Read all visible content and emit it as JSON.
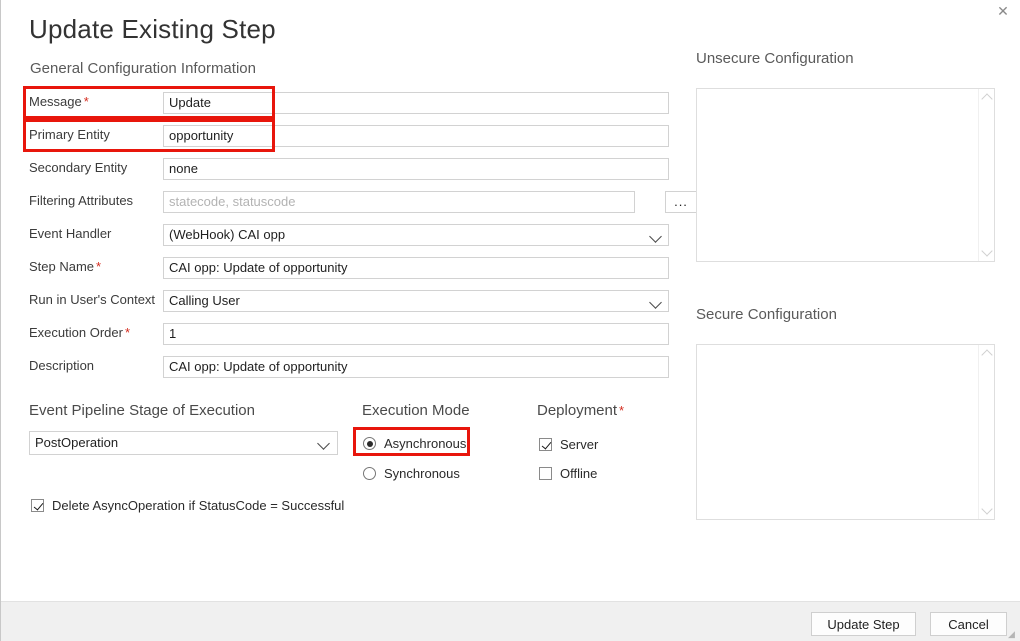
{
  "window": {
    "title": "Update Existing Step",
    "close_icon": "close-icon"
  },
  "general": {
    "section_title": "General Configuration Information",
    "rows": [
      {
        "label": "Message",
        "required": true,
        "value": "Update",
        "type": "text",
        "highlight": true
      },
      {
        "label": "Primary Entity",
        "required": false,
        "value": "opportunity",
        "type": "text",
        "highlight": true
      },
      {
        "label": "Secondary Entity",
        "required": false,
        "value": "none",
        "type": "text",
        "highlight": false
      },
      {
        "label": "Filtering Attributes",
        "required": false,
        "value": "statecode, statuscode",
        "type": "placeholder",
        "highlight": false,
        "ellipsis": "..."
      },
      {
        "label": "Event Handler",
        "required": false,
        "value": "(WebHook) CAI opp",
        "type": "select",
        "highlight": false
      },
      {
        "label": "Step Name",
        "required": true,
        "value": "CAI opp: Update of opportunity",
        "type": "text",
        "highlight": false
      },
      {
        "label": "Run in User's Context",
        "required": false,
        "value": "Calling User",
        "type": "select",
        "highlight": false
      },
      {
        "label": "Execution Order",
        "required": true,
        "value": "1",
        "type": "text",
        "highlight": false
      },
      {
        "label": "Description",
        "required": false,
        "value": "CAI opp: Update of opportunity",
        "type": "text",
        "highlight": false
      }
    ]
  },
  "pipeline": {
    "heading": "Event Pipeline Stage of Execution",
    "selected": "PostOperation"
  },
  "execution_mode": {
    "heading": "Execution Mode",
    "options": [
      {
        "label": "Asynchronous",
        "selected": true,
        "highlight": true
      },
      {
        "label": "Synchronous",
        "selected": false,
        "highlight": false
      }
    ]
  },
  "deployment": {
    "heading": "Deployment",
    "required": true,
    "options": [
      {
        "label": "Server",
        "checked": true
      },
      {
        "label": "Offline",
        "checked": false
      }
    ]
  },
  "delete_async": {
    "label": "Delete AsyncOperation if StatusCode = Successful",
    "checked": true
  },
  "unsecure_configuration": {
    "title": "Unsecure  Configuration",
    "value": ""
  },
  "secure_configuration": {
    "title": "Secure  Configuration",
    "value": ""
  },
  "footer": {
    "update_label": "Update Step",
    "cancel_label": "Cancel"
  },
  "colors": {
    "highlight_red": "#e8160c",
    "required_red": "#d42b1e",
    "title_gray": "#333333",
    "footer_bg": "#f0f0f0"
  }
}
